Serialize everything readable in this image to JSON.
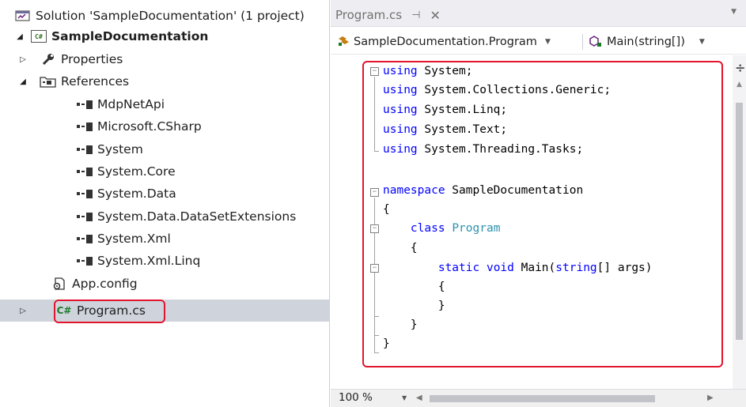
{
  "solution_explorer": {
    "items": [
      {
        "label": "Solution 'SampleDocumentation' (1 project)",
        "icon": "solution-icon"
      },
      {
        "label": "SampleDocumentation",
        "icon": "csharp-project-icon"
      },
      {
        "label": "Properties",
        "icon": "wrench-icon"
      },
      {
        "label": "References",
        "icon": "references-folder-icon"
      },
      {
        "label": "MdpNetApi",
        "icon": "reference-icon"
      },
      {
        "label": "Microsoft.CSharp",
        "icon": "reference-icon"
      },
      {
        "label": "System",
        "icon": "reference-icon"
      },
      {
        "label": "System.Core",
        "icon": "reference-icon"
      },
      {
        "label": "System.Data",
        "icon": "reference-icon"
      },
      {
        "label": "System.Data.DataSetExtensions",
        "icon": "reference-icon"
      },
      {
        "label": "System.Xml",
        "icon": "reference-icon"
      },
      {
        "label": "System.Xml.Linq",
        "icon": "reference-icon"
      },
      {
        "label": "App.config",
        "icon": "config-file-icon"
      },
      {
        "label": "Program.cs",
        "icon": "csharp-file-icon"
      }
    ],
    "selected": "Program.cs",
    "project_icon_text": "C#",
    "file_icon_text": "C#"
  },
  "editor": {
    "tab": {
      "label": "Program.cs",
      "pin": "⊣",
      "close": "✕"
    },
    "nav": {
      "type_combo": "SampleDocumentation.Program",
      "member_combo": "Main(string[])"
    },
    "code": [
      [
        {
          "t": "using",
          "c": "kw"
        },
        {
          "t": " System;",
          "c": "pl"
        }
      ],
      [
        {
          "t": "using",
          "c": "kw"
        },
        {
          "t": " System.Collections.Generic;",
          "c": "pl"
        }
      ],
      [
        {
          "t": "using",
          "c": "kw"
        },
        {
          "t": " System.Linq;",
          "c": "pl"
        }
      ],
      [
        {
          "t": "using",
          "c": "kw"
        },
        {
          "t": " System.Text;",
          "c": "pl"
        }
      ],
      [
        {
          "t": "using",
          "c": "kw"
        },
        {
          "t": " System.Threading.Tasks;",
          "c": "pl"
        }
      ],
      [],
      [
        {
          "t": "namespace",
          "c": "kw"
        },
        {
          "t": " SampleDocumentation",
          "c": "pl"
        }
      ],
      [
        {
          "t": "{",
          "c": "pl"
        }
      ],
      [
        {
          "t": "    ",
          "c": "pl"
        },
        {
          "t": "class",
          "c": "kw"
        },
        {
          "t": " ",
          "c": "pl"
        },
        {
          "t": "Program",
          "c": "ty"
        }
      ],
      [
        {
          "t": "    {",
          "c": "pl"
        }
      ],
      [
        {
          "t": "        ",
          "c": "pl"
        },
        {
          "t": "static",
          "c": "kw"
        },
        {
          "t": " ",
          "c": "pl"
        },
        {
          "t": "void",
          "c": "kw"
        },
        {
          "t": " Main(",
          "c": "pl"
        },
        {
          "t": "string",
          "c": "kw"
        },
        {
          "t": "[] args)",
          "c": "pl"
        }
      ],
      [
        {
          "t": "        {",
          "c": "pl"
        }
      ],
      [
        {
          "t": "        }",
          "c": "pl"
        }
      ],
      [
        {
          "t": "    }",
          "c": "pl"
        }
      ],
      [
        {
          "t": "}",
          "c": "pl"
        }
      ]
    ],
    "zoom": "100 %"
  },
  "colors": {
    "keyword": "#0000ff",
    "type": "#2b91af",
    "highlight": "#e3142d",
    "selection": "#cfd4dc"
  }
}
